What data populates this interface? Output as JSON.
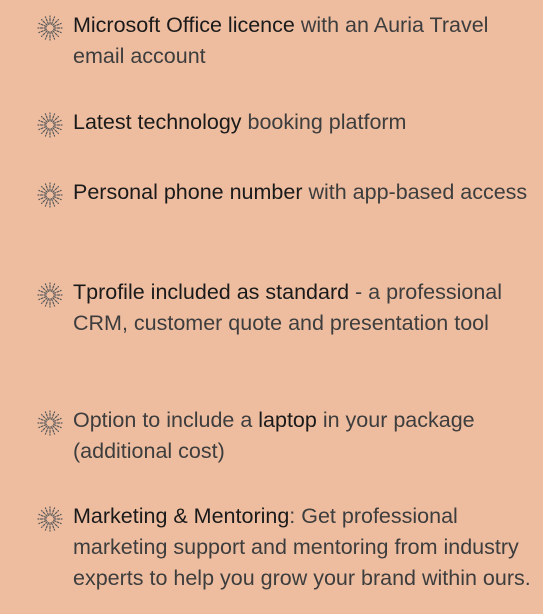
{
  "icon": "starburst-icon",
  "colors": {
    "background": "#eebda0",
    "text": "#3d3d3d",
    "highlight": "#1a1a1a",
    "icon": "#5a5a5a"
  },
  "items": [
    {
      "bold": "Microsoft Office licence",
      "rest": " with an Auria Travel email account"
    },
    {
      "bold": "Latest technology",
      "rest": " booking platform"
    },
    {
      "bold": "Personal phone number",
      "rest": " with app-based access"
    },
    {
      "bold": "Tprofile included as standard",
      "rest": " - a professional CRM, customer quote and presentation tool"
    },
    {
      "pre": "Option to include a ",
      "bold": "laptop",
      "rest": " in your package (additional cost)"
    },
    {
      "bold": "Marketing & Mentoring",
      "rest": ": Get professional marketing support and mentoring from industry experts to help you grow your brand within ours."
    }
  ]
}
